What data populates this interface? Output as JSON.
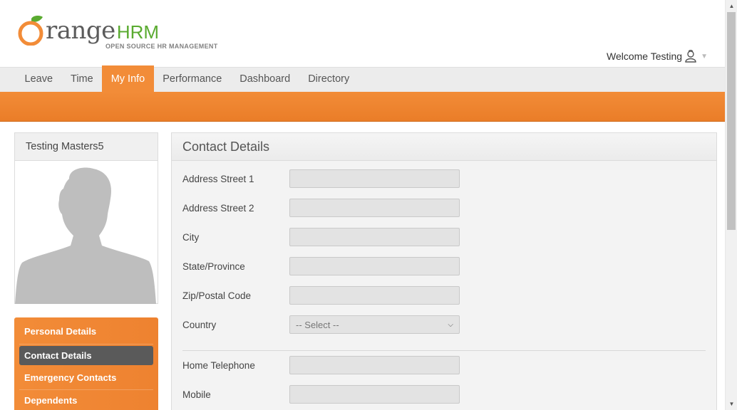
{
  "header": {
    "logo_word": "range",
    "logo_hrm": "HRM",
    "logo_subtitle": "OPEN SOURCE HR MANAGEMENT",
    "welcome_text": "Welcome Testing"
  },
  "nav": {
    "items": [
      {
        "label": "Leave"
      },
      {
        "label": "Time"
      },
      {
        "label": "My Info"
      },
      {
        "label": "Performance"
      },
      {
        "label": "Dashboard"
      },
      {
        "label": "Directory"
      }
    ],
    "active": "My Info"
  },
  "profile": {
    "name": "Testing Masters5"
  },
  "side_menu": {
    "items": [
      {
        "label": "Personal Details"
      },
      {
        "label": "Contact Details"
      },
      {
        "label": "Emergency Contacts"
      },
      {
        "label": "Dependents"
      }
    ],
    "active": "Contact Details"
  },
  "panel": {
    "title": "Contact Details",
    "fields": {
      "street1": {
        "label": "Address Street 1",
        "value": ""
      },
      "street2": {
        "label": "Address Street 2",
        "value": ""
      },
      "city": {
        "label": "City",
        "value": ""
      },
      "state": {
        "label": "State/Province",
        "value": ""
      },
      "zip": {
        "label": "Zip/Postal Code",
        "value": ""
      },
      "country": {
        "label": "Country",
        "selected": "-- Select --"
      },
      "home_phone": {
        "label": "Home Telephone",
        "value": ""
      },
      "mobile": {
        "label": "Mobile",
        "value": ""
      }
    }
  },
  "colors": {
    "accent": "#f28c38",
    "logo_green": "#5aab30",
    "active_side_item": "#5a5a5a"
  }
}
